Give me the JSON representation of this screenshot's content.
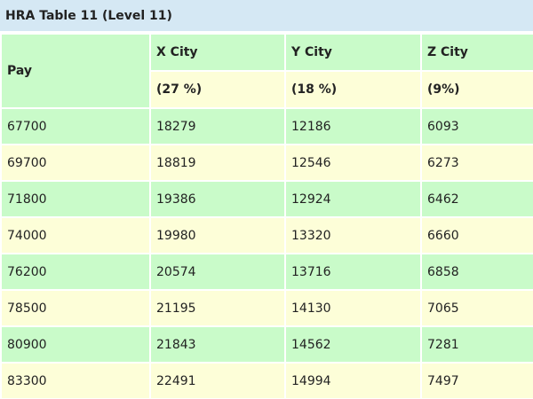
{
  "caption": "HRA Table 11 (Level 11)",
  "headers": {
    "pay": "Pay",
    "x_city": "X City",
    "y_city": "Y City",
    "z_city": "Z City",
    "x_rate": "(27 %)",
    "y_rate": "(18 %)",
    "z_rate": "(9%)"
  },
  "rows": [
    [
      "67700",
      "18279",
      "12186",
      "6093"
    ],
    [
      "69700",
      "18819",
      "12546",
      "6273"
    ],
    [
      "71800",
      "19386",
      "12924",
      "6462"
    ],
    [
      "74000",
      "19980",
      "13320",
      "6660"
    ],
    [
      "76200",
      "20574",
      "13716",
      "6858"
    ],
    [
      "78500",
      "21195",
      "14130",
      "7065"
    ],
    [
      "80900",
      "21843",
      "14562",
      "7281"
    ],
    [
      "83300",
      "22491",
      "14994",
      "7497"
    ]
  ],
  "colors": {
    "caption_bg": "#d5e8f4",
    "green_row": "#c9fbc9",
    "cream_row": "#fdfed8"
  }
}
